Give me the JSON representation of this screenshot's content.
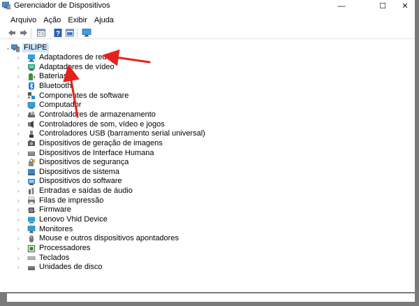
{
  "window": {
    "title": "Gerenciador de Dispositivos",
    "minimize_glyph": "—",
    "maximize_glyph": "☐",
    "close_glyph": "✕"
  },
  "menu": [
    "Arquivo",
    "Ação",
    "Exibir",
    "Ajuda"
  ],
  "toolbar": {
    "buttons": [
      "back-icon",
      "forward-icon",
      "properties-icon",
      "help-icon",
      "update-icon",
      "monitor-scan-icon"
    ]
  },
  "tree": {
    "root": "FILIPE",
    "items": [
      {
        "label": "Adaptadores de rede",
        "icon": "network-adapter-icon"
      },
      {
        "label": "Adaptadores de vídeo",
        "icon": "display-adapter-icon"
      },
      {
        "label": "Baterias",
        "icon": "battery-icon"
      },
      {
        "label": "Bluetooth",
        "icon": "bluetooth-icon"
      },
      {
        "label": "Componentes de software",
        "icon": "software-component-icon"
      },
      {
        "label": "Computador",
        "icon": "computer-icon"
      },
      {
        "label": "Controladores de armazenamento",
        "icon": "storage-controller-icon"
      },
      {
        "label": "Controladores de som, vídeo e jogos",
        "icon": "sound-icon"
      },
      {
        "label": "Controladores USB (barramento serial universal)",
        "icon": "usb-icon"
      },
      {
        "label": "Dispositivos de geração de imagens",
        "icon": "imaging-icon"
      },
      {
        "label": "Dispositivos de Interface Humana",
        "icon": "hid-icon"
      },
      {
        "label": "Dispositivos de segurança",
        "icon": "security-icon"
      },
      {
        "label": "Dispositivos de sistema",
        "icon": "system-device-icon"
      },
      {
        "label": "Dispositivos do software",
        "icon": "software-device-icon"
      },
      {
        "label": "Entradas e saídas de áudio",
        "icon": "audio-io-icon"
      },
      {
        "label": "Filas de impressão",
        "icon": "print-queue-icon"
      },
      {
        "label": "Firmware",
        "icon": "firmware-icon"
      },
      {
        "label": "Lenovo Vhid Device",
        "icon": "lenovo-device-icon"
      },
      {
        "label": "Monitores",
        "icon": "monitor-icon"
      },
      {
        "label": "Mouse e outros dispositivos apontadores",
        "icon": "mouse-icon"
      },
      {
        "label": "Processadores",
        "icon": "processor-icon"
      },
      {
        "label": "Teclados",
        "icon": "keyboard-icon"
      },
      {
        "label": "Unidades de disco",
        "icon": "disk-drive-icon"
      }
    ]
  },
  "colors": {
    "selection": "#cce8ff",
    "annotation_arrow": "#e8201c"
  }
}
